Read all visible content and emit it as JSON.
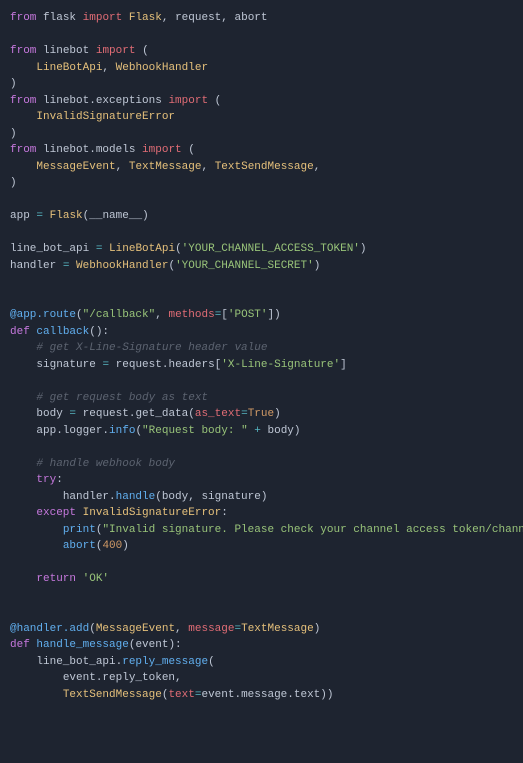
{
  "l1": {
    "t0": "from",
    "t1": "flask",
    "t2": "import",
    "t3": "Flask",
    "t4": ", request, abort"
  },
  "l2": {
    "t0": "from",
    "t1": "linebot",
    "t2": "import",
    "t3": "("
  },
  "l3": {
    "t0": "LineBotApi",
    "t1": ",",
    "t2": "WebhookHandler"
  },
  "l4": {
    "t0": ")"
  },
  "l5": {
    "t0": "from",
    "t1": "linebot.exceptions",
    "t2": "import",
    "t3": "("
  },
  "l6": {
    "t0": "InvalidSignatureError"
  },
  "l7": {
    "t0": ")"
  },
  "l8": {
    "t0": "from",
    "t1": "linebot.models",
    "t2": "import",
    "t3": "("
  },
  "l9": {
    "t0": "MessageEvent",
    "t1": ",",
    "t2": "TextMessage",
    "t3": ",",
    "t4": "TextSendMessage",
    "t5": ","
  },
  "l10": {
    "t0": ")"
  },
  "l11": {
    "t0": "app",
    "t1": "=",
    "t2": "Flask",
    "t3": "(__name__)"
  },
  "l12": {
    "t0": "line_bot_api",
    "t1": "=",
    "t2": "LineBotApi",
    "t3": "(",
    "t4": "'YOUR_CHANNEL_ACCESS_TOKEN'",
    "t5": ")"
  },
  "l13": {
    "t0": "handler",
    "t1": "=",
    "t2": "WebhookHandler",
    "t3": "(",
    "t4": "'YOUR_CHANNEL_SECRET'",
    "t5": ")"
  },
  "l14": {
    "t0": "@app.route",
    "t1": "(",
    "t2": "\"/callback\"",
    "t3": ",",
    "t4": "methods",
    "t5": "=",
    "t6": "[",
    "t7": "'POST'",
    "t8": "])"
  },
  "l15": {
    "t0": "def",
    "t1": "callback",
    "t2": "():"
  },
  "l16": {
    "t0": "# get X-Line-Signature header value"
  },
  "l17": {
    "t0": "signature",
    "t1": "=",
    "t2": "request.headers[",
    "t3": "'X-Line-Signature'",
    "t4": "]"
  },
  "l18": {
    "t0": "# get request body as text"
  },
  "l19": {
    "t0": "body",
    "t1": "=",
    "t2": "request.get_data(",
    "t3": "as_text",
    "t4": "=",
    "t5": "True",
    "t6": ")"
  },
  "l20": {
    "t0": "app.logger.",
    "t1": "info",
    "t2": "(",
    "t3": "\"Request body: \"",
    "t4": "+",
    "t5": "body)"
  },
  "l21": {
    "t0": "# handle webhook body"
  },
  "l22": {
    "t0": "try",
    "t1": ":"
  },
  "l23": {
    "t0": "handler.",
    "t1": "handle",
    "t2": "(body, signature)"
  },
  "l24": {
    "t0": "except",
    "t1": "InvalidSignatureError",
    "t2": ":"
  },
  "l25": {
    "t0": "print",
    "t1": "(",
    "t2": "\"Invalid signature. Please check your channel access token/channel secret.\"",
    "t3": ")"
  },
  "l26": {
    "t0": "abort",
    "t1": "(",
    "t2": "400",
    "t3": ")"
  },
  "l27": {
    "t0": "return",
    "t1": "'OK'"
  },
  "l28": {
    "t0": "@handler.add",
    "t1": "(",
    "t2": "MessageEvent",
    "t3": ",",
    "t4": "message",
    "t5": "=",
    "t6": "TextMessage",
    "t7": ")"
  },
  "l29": {
    "t0": "def",
    "t1": "handle_message",
    "t2": "(event):"
  },
  "l30": {
    "t0": "line_bot_api.",
    "t1": "reply_message",
    "t2": "("
  },
  "l31": {
    "t0": "event.reply_token,"
  },
  "l32": {
    "t0": "TextSendMessage",
    "t1": "(",
    "t2": "text",
    "t3": "=",
    "t4": "event.message.text))"
  }
}
